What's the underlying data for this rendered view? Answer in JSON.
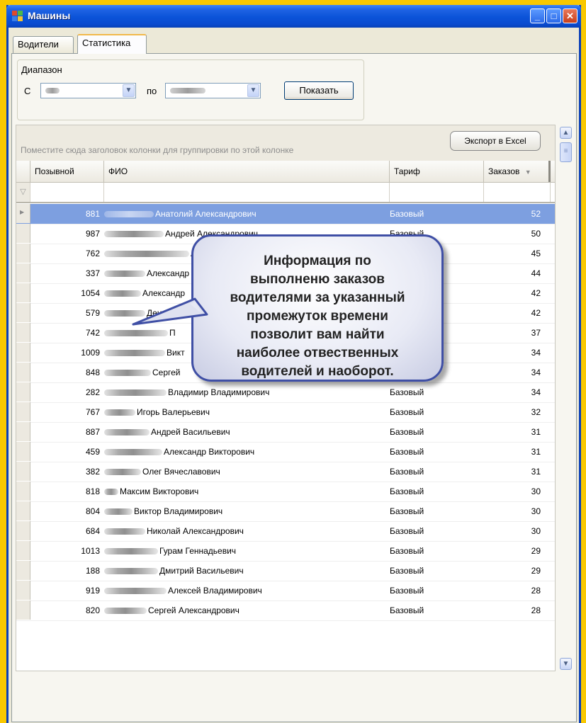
{
  "window": {
    "title": "Машины"
  },
  "tabs": [
    {
      "label": "Водители",
      "active": false
    },
    {
      "label": "Статистика",
      "active": true
    }
  ],
  "range": {
    "group_label": "Диапазон",
    "from_label": "С",
    "to_label": "по",
    "show_button": "Показать"
  },
  "grid": {
    "group_hint": "Поместите сюда заголовок колонки для группировки по этой колонке",
    "export_button": "Экспорт в Excel",
    "columns": {
      "callsign": "Позывной",
      "fio": "ФИО",
      "tariff": "Тариф",
      "orders": "Заказов"
    },
    "rows": [
      {
        "callsign": "881",
        "fio": "Анатолий Александрович",
        "tariff": "Базовый",
        "orders": "52",
        "selected": true
      },
      {
        "callsign": "987",
        "fio": "Андрей Александрович",
        "tariff": "Базовый",
        "orders": "50"
      },
      {
        "callsign": "762",
        "fio": "Александр",
        "tariff": "",
        "orders": "45"
      },
      {
        "callsign": "337",
        "fio": "Александр",
        "tariff": "",
        "orders": "44"
      },
      {
        "callsign": "1054",
        "fio": "Александр",
        "tariff": "",
        "orders": "42"
      },
      {
        "callsign": "579",
        "fio": "Денис В",
        "tariff": "",
        "orders": "42"
      },
      {
        "callsign": "742",
        "fio": "П",
        "tariff": "",
        "orders": "37"
      },
      {
        "callsign": "1009",
        "fio": "Викт",
        "tariff": "",
        "orders": "34"
      },
      {
        "callsign": "848",
        "fio": "Сергей",
        "tariff": "",
        "orders": "34"
      },
      {
        "callsign": "282",
        "fio": "Владимир Владимирович",
        "tariff": "Базовый",
        "orders": "34"
      },
      {
        "callsign": "767",
        "fio": "Игорь Валерьевич",
        "tariff": "Базовый",
        "orders": "32"
      },
      {
        "callsign": "887",
        "fio": "Андрей Васильевич",
        "tariff": "Базовый",
        "orders": "31"
      },
      {
        "callsign": "459",
        "fio": "Александр Викторович",
        "tariff": "Базовый",
        "orders": "31"
      },
      {
        "callsign": "382",
        "fio": "Олег Вячеславович",
        "tariff": "Базовый",
        "orders": "31"
      },
      {
        "callsign": "818",
        "fio": "Максим Викторович",
        "tariff": "Базовый",
        "orders": "30"
      },
      {
        "callsign": "804",
        "fio": "Виктор Владимирович",
        "tariff": "Базовый",
        "orders": "30"
      },
      {
        "callsign": "684",
        "fio": "Николай Александрович",
        "tariff": "Базовый",
        "orders": "30"
      },
      {
        "callsign": "1013",
        "fio": "Гурам Геннадьевич",
        "tariff": "Базовый",
        "orders": "29"
      },
      {
        "callsign": "188",
        "fio": "Дмитрий Васильевич",
        "tariff": "Базовый",
        "orders": "29"
      },
      {
        "callsign": "919",
        "fio": "Алексей Владимирович",
        "tariff": "Базовый",
        "orders": "28"
      },
      {
        "callsign": "820",
        "fio": "Сергей Александрович",
        "tariff": "Базовый",
        "orders": "28"
      }
    ]
  },
  "callout": {
    "text": "Информация по\nвыполненю заказов\nводителями за указанный\nпромежуток времени\nпозволит вам найти\nнаиболее отвественных\nводителей и наоборот."
  },
  "colors": {
    "background": "#f9c800",
    "titlebar": "#0b53d8",
    "selected_row": "#7d9fe0"
  }
}
